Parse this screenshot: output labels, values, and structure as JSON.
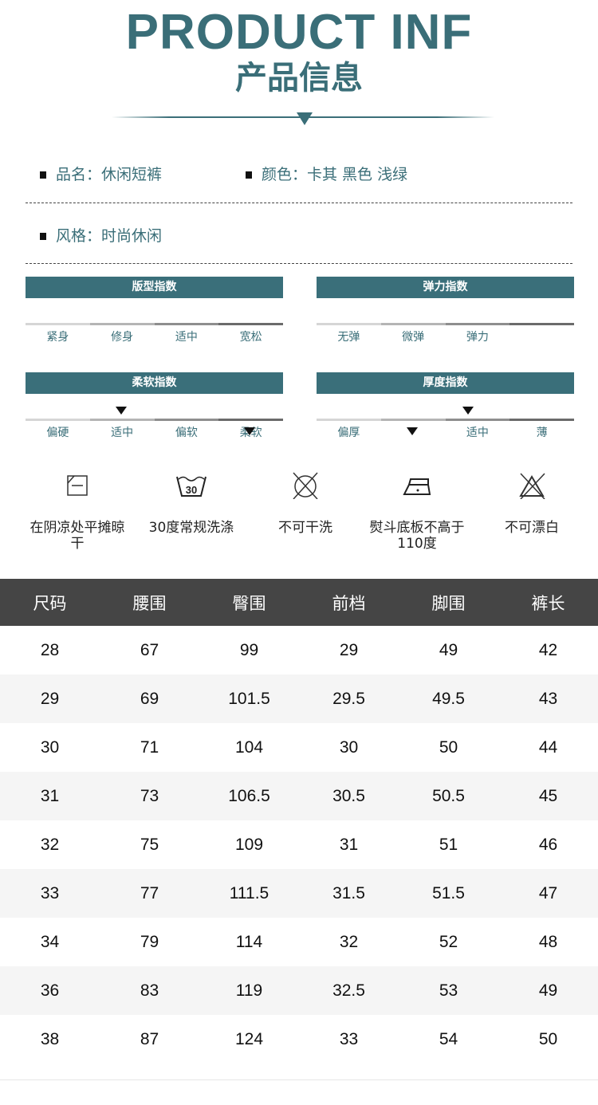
{
  "header": {
    "title_en": "PRODUCT INF",
    "title_cn": "产品信息",
    "accent_color": "#3a6e78"
  },
  "attributes": {
    "name": "品名：休闲短裤",
    "color": "颜色：卡其 黑色 浅绿",
    "style": "风格：时尚休闲"
  },
  "indices": [
    {
      "title": "版型指数",
      "labels": [
        "紧身",
        "修身",
        "适中",
        "宽松"
      ],
      "selected": null
    },
    {
      "title": "弹力指数",
      "labels": [
        "无弹",
        "微弹",
        "弹力",
        ""
      ],
      "selected": null
    },
    {
      "title": "柔软指数",
      "labels": [
        "偏硬",
        "适中",
        "偏软",
        "柔软"
      ],
      "selected": "适中"
    },
    {
      "title": "厚度指数",
      "labels": [
        "偏厚",
        "",
        "适中",
        "薄"
      ],
      "selected": "适中"
    }
  ],
  "care": [
    {
      "icon": "dry-flat-shade-icon",
      "text": "在阴凉处平摊晾干"
    },
    {
      "icon": "wash-30-icon",
      "text": "30度常规洗涤"
    },
    {
      "icon": "no-dry-clean-icon",
      "text": "不可干洗"
    },
    {
      "icon": "iron-low-icon",
      "text": "熨斗底板不高于110度"
    },
    {
      "icon": "no-bleach-icon",
      "text": "不可漂白"
    }
  ],
  "size_table": {
    "headers": [
      "尺码",
      "腰围",
      "臀围",
      "前档",
      "脚围",
      "裤长"
    ],
    "rows": [
      [
        "28",
        "67",
        "99",
        "29",
        "49",
        "42"
      ],
      [
        "29",
        "69",
        "101.5",
        "29.5",
        "49.5",
        "43"
      ],
      [
        "30",
        "71",
        "104",
        "30",
        "50",
        "44"
      ],
      [
        "31",
        "73",
        "106.5",
        "30.5",
        "50.5",
        "45"
      ],
      [
        "32",
        "75",
        "109",
        "31",
        "51",
        "46"
      ],
      [
        "33",
        "77",
        "111.5",
        "31.5",
        "51.5",
        "47"
      ],
      [
        "34",
        "79",
        "114",
        "32",
        "52",
        "48"
      ],
      [
        "36",
        "83",
        "119",
        "32.5",
        "53",
        "49"
      ],
      [
        "38",
        "87",
        "124",
        "33",
        "54",
        "50"
      ]
    ]
  }
}
